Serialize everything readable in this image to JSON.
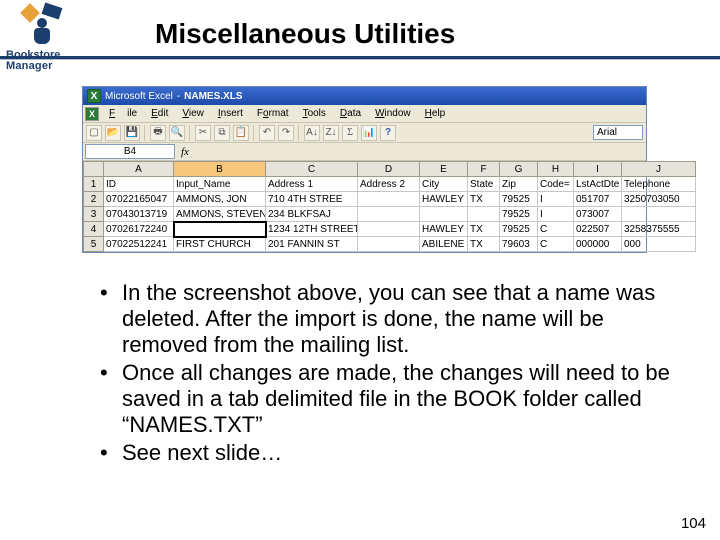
{
  "logo": {
    "line1": "Bookstore",
    "line2": "Manager"
  },
  "title": "Miscellaneous Utilities",
  "excel": {
    "app": "Microsoft Excel",
    "filename": "NAMES.XLS",
    "menu": {
      "file": "File",
      "edit": "Edit",
      "view": "View",
      "insert": "Insert",
      "format": "Format",
      "tools": "Tools",
      "data": "Data",
      "window": "Window",
      "help": "Help"
    },
    "fontname": "Arial",
    "namebox": "B4",
    "fx": "fx",
    "columns": [
      "A",
      "B",
      "C",
      "D",
      "E",
      "F",
      "G",
      "H",
      "I",
      "J"
    ],
    "header_row": {
      "A": "ID",
      "B": "Input_Name",
      "C": "Address 1",
      "D": "Address 2",
      "E": "City",
      "F": "State",
      "G": "Zip",
      "H": "Code=",
      "I": "LstActDte",
      "J": "Telephone"
    },
    "rows": [
      {
        "n": "2",
        "A": "07022165047",
        "B": "AMMONS, JON",
        "C": "710 4TH STREE",
        "D": "",
        "E": "HAWLEY",
        "F": "TX",
        "G": "79525",
        "H": "I",
        "I": "051707",
        "J": "3250703050"
      },
      {
        "n": "3",
        "A": "07043013719",
        "B": "AMMONS, STEVEN",
        "C": "234 BLKFSAJ",
        "D": "",
        "E": "",
        "F": "",
        "G": "79525",
        "H": "I",
        "I": "073007",
        "J": ""
      },
      {
        "n": "4",
        "A": "07026172240",
        "B": "",
        "C": "1234 12TH STREET",
        "D": "",
        "E": "HAWLEY",
        "F": "TX",
        "G": "79525",
        "H": "C",
        "I": "022507",
        "J": "3258375555"
      },
      {
        "n": "5",
        "A": "07022512241",
        "B": "FIRST CHURCH",
        "C": "201 FANNIN ST",
        "D": "",
        "E": "ABILENE",
        "F": "TX",
        "G": "79603",
        "H": "C",
        "I": "000000",
        "J": "000"
      }
    ]
  },
  "bullets": [
    "In the screenshot above, you can see that a name was deleted.  After the import is done, the name will be removed from the mailing list.",
    "Once all changes are made, the changes will need to be saved in a tab delimited file in the BOOK folder called “NAMES.TXT”",
    "See next slide…"
  ],
  "page_number": "104"
}
